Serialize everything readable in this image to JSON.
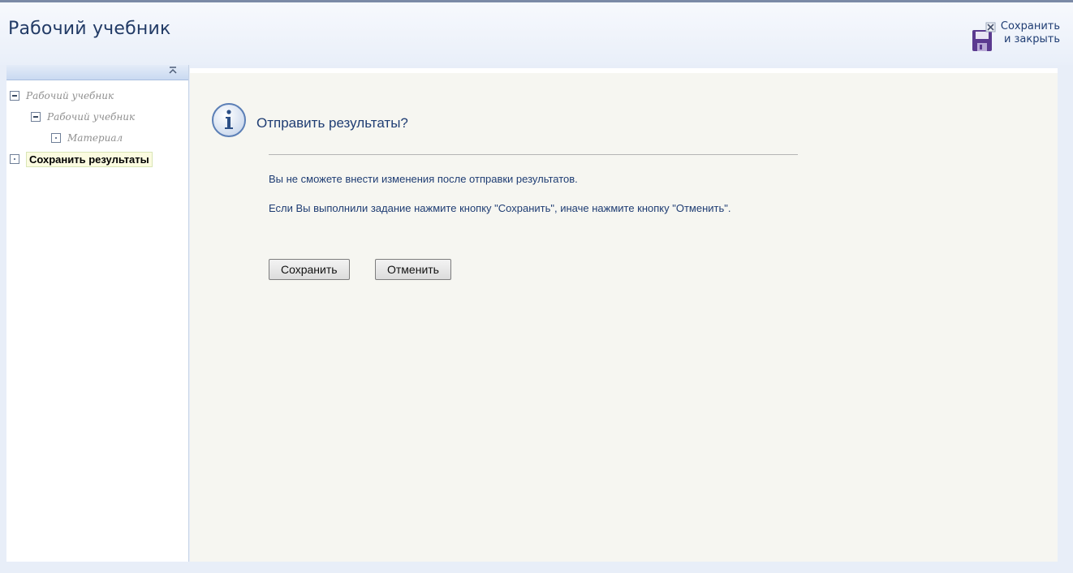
{
  "header": {
    "title": "Рабочий учебник",
    "save_close": {
      "line1": "Сохранить",
      "line2": "и закрыть",
      "icon": "floppy-disk-close-icon"
    }
  },
  "sidebar": {
    "collapse_icon": "collapse-up-icon",
    "tree": [
      {
        "label": "Рабочий учебник",
        "level": 0,
        "state": "expanded"
      },
      {
        "label": "Рабочий учебник",
        "level": 1,
        "state": "expanded"
      },
      {
        "label": "Материал",
        "level": 2,
        "state": "leaf"
      },
      {
        "label": "Сохранить результаты",
        "level": 0,
        "state": "leaf",
        "active": true
      }
    ]
  },
  "dialog": {
    "icon": "info-icon",
    "title": "Отправить результаты?",
    "message1": "Вы не сможете внести изменения после отправки результатов.",
    "message2": "Если Вы выполнили задание нажмите кнопку \"Сохранить\", иначе нажмите кнопку \"Отменить\".",
    "save_button": "Сохранить",
    "cancel_button": "Отменить"
  },
  "colors": {
    "title_text": "#223b66",
    "body_text": "#1f3d73",
    "main_bg": "#f6f6f1",
    "page_bg": "#e8eef8"
  }
}
